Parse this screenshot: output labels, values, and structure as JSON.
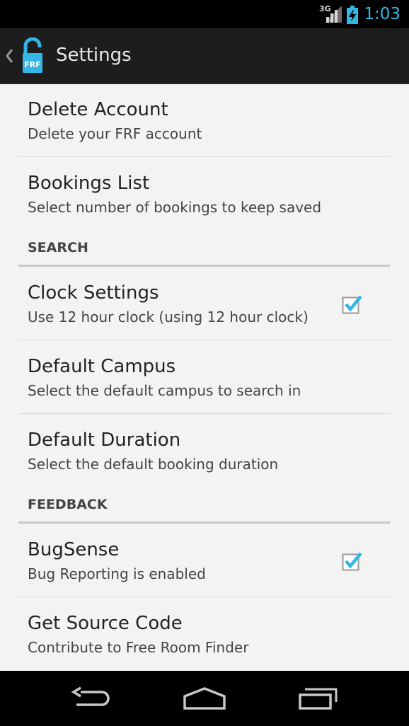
{
  "status_bar": {
    "network": "3G",
    "time": "1:03",
    "icons": [
      "signal-icon",
      "battery-charging-icon"
    ]
  },
  "action_bar": {
    "title": "Settings",
    "app_icon_text": "FRF",
    "icons": [
      "back-chevron-icon",
      "app-lock-icon"
    ]
  },
  "settings": {
    "delete_account": {
      "title": "Delete Account",
      "summary": "Delete your FRF account"
    },
    "bookings_list": {
      "title": "Bookings List",
      "summary": "Select number of bookings to keep saved"
    },
    "search_category": "SEARCH",
    "clock_settings": {
      "title": "Clock Settings",
      "summary": "Use 12 hour clock (using 12 hour clock)",
      "checked": true
    },
    "default_campus": {
      "title": "Default Campus",
      "summary": "Select the default campus to search in"
    },
    "default_duration": {
      "title": "Default Duration",
      "summary": "Select the default booking duration"
    },
    "feedback_category": "FEEDBACK",
    "bugsense": {
      "title": "BugSense",
      "summary": "Bug Reporting is enabled",
      "checked": true
    },
    "source_code": {
      "title": "Get Source Code",
      "summary": "Contribute to Free Room Finder"
    }
  },
  "nav_bar": {
    "icons": [
      "back-icon",
      "home-icon",
      "recent-apps-icon"
    ]
  },
  "colors": {
    "accent": "#33b5e5",
    "action_bar": "#1d1d1d",
    "background": "#f3f3f3"
  }
}
